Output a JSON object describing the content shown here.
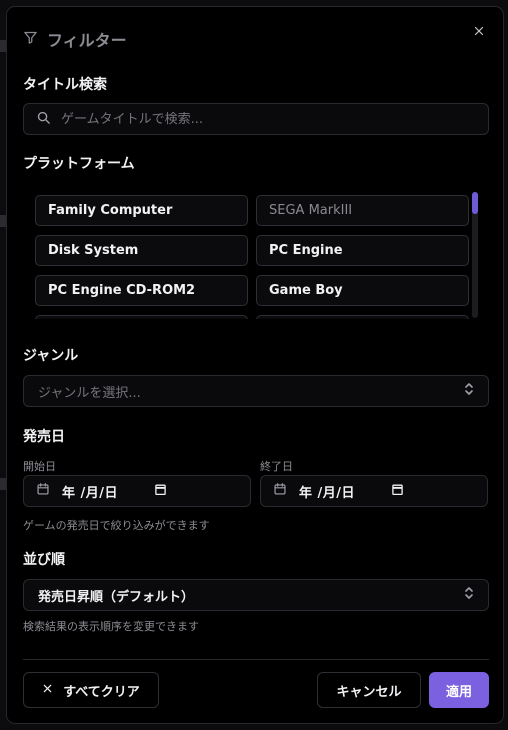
{
  "dialog": {
    "title": "フィルター",
    "close_icon": "close-icon"
  },
  "search": {
    "label": "タイトル検索",
    "placeholder": "ゲームタイトルで検索..."
  },
  "platform": {
    "label": "プラットフォーム",
    "items": [
      {
        "label": "Family Computer",
        "muted": false
      },
      {
        "label": "SEGA MarkIII",
        "muted": true
      },
      {
        "label": "Disk System",
        "muted": false
      },
      {
        "label": "PC Engine",
        "muted": false
      },
      {
        "label": "PC Engine CD-ROM2",
        "muted": false
      },
      {
        "label": "Game Boy",
        "muted": false
      }
    ]
  },
  "genre": {
    "label": "ジャンル",
    "placeholder": "ジャンルを選択..."
  },
  "release": {
    "label": "発売日",
    "start_label": "開始日",
    "end_label": "終了日",
    "start_value": "年 /月/日",
    "end_value": "年 /月/日",
    "helper": "ゲームの発売日で絞り込みができます"
  },
  "sort": {
    "label": "並び順",
    "value": "発売日昇順（デフォルト）",
    "helper": "検索結果の表示順序を変更できます"
  },
  "footer": {
    "clear_label": "すべてクリア",
    "cancel_label": "キャンセル",
    "apply_label": "適用"
  },
  "colors": {
    "accent": "#7b61e0",
    "background": "#000000",
    "border": "#2a2a30"
  }
}
